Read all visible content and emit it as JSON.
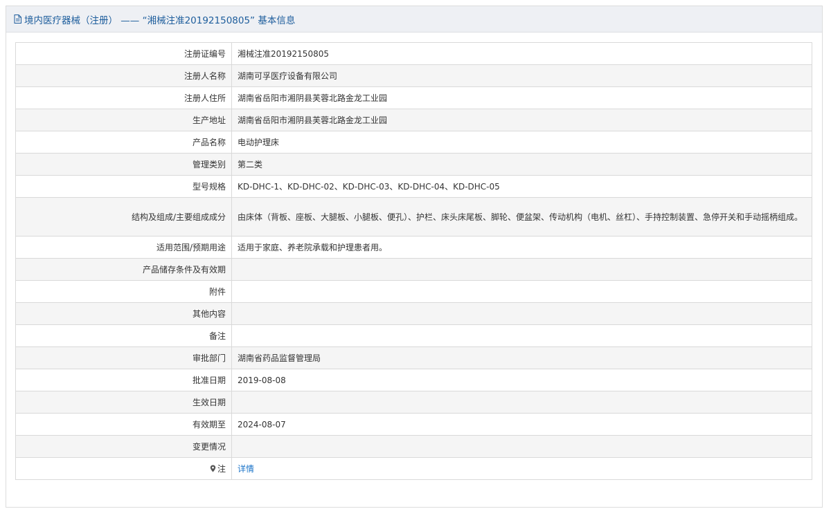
{
  "header": {
    "title": "境内医疗器械（注册） —— “湘械注准20192150805” 基本信息",
    "icon": "document-icon"
  },
  "rows": [
    {
      "label": "注册证编号",
      "value": "湘械注准20192150805"
    },
    {
      "label": "注册人名称",
      "value": "湖南可孚医疗设备有限公司"
    },
    {
      "label": "注册人住所",
      "value": "湖南省岳阳市湘阴县芙蓉北路金龙工业园"
    },
    {
      "label": "生产地址",
      "value": "湖南省岳阳市湘阴县芙蓉北路金龙工业园"
    },
    {
      "label": "产品名称",
      "value": "电动护理床"
    },
    {
      "label": "管理类别",
      "value": "第二类"
    },
    {
      "label": "型号规格",
      "value": "KD-DHC-1、KD-DHC-02、KD-DHC-03、KD-DHC-04、KD-DHC-05"
    },
    {
      "label": "结构及组成/主要组成成分",
      "value": "由床体（背板、座板、大腿板、小腿板、便孔）、护栏、床头床尾板、脚轮、便盆架、传动机构（电机、丝杠）、手持控制装置、急停开关和手动摇柄组成。"
    },
    {
      "label": "适用范围/预期用途",
      "value": "适用于家庭、养老院承载和护理患者用。"
    },
    {
      "label": "产品储存条件及有效期",
      "value": ""
    },
    {
      "label": "附件",
      "value": ""
    },
    {
      "label": "其他内容",
      "value": ""
    },
    {
      "label": "备注",
      "value": ""
    },
    {
      "label": "审批部门",
      "value": "湖南省药品监督管理局"
    },
    {
      "label": "批准日期",
      "value": "2019-08-08"
    },
    {
      "label": "生效日期",
      "value": ""
    },
    {
      "label": "有效期至",
      "value": "2024-08-07"
    },
    {
      "label": "变更情况",
      "value": ""
    }
  ],
  "note_row": {
    "label": "注",
    "icon": "map-pin-icon",
    "link_text": "详情"
  },
  "colors": {
    "header_text": "#1d5d9c",
    "header_bg": "#eef0f4",
    "link": "#1a73c8",
    "alt_row_bg": "#f5f5f5"
  }
}
